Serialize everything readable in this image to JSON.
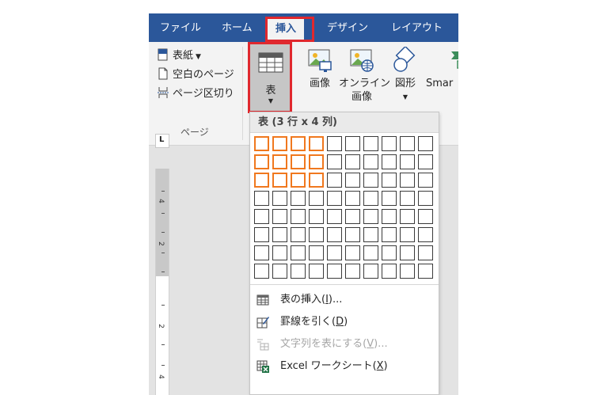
{
  "tabs": [
    {
      "label": "ファイル"
    },
    {
      "label": "ホーム"
    },
    {
      "label": "挿入"
    },
    {
      "label": "デザイン"
    },
    {
      "label": "レイアウト"
    }
  ],
  "active_tab": "挿入",
  "ribbon": {
    "pages_group": {
      "cover_page": "表紙",
      "blank_page": "空白のページ",
      "page_break": "ページ区切り",
      "label": "ページ"
    },
    "table_button": "表",
    "pictures_button": "画像",
    "online_pictures_line1": "オンライン",
    "online_pictures_line2": "画像",
    "shapes_button": "図形",
    "smartart_button": "Smar"
  },
  "colors": {
    "tab_bar": "#2b579a",
    "highlight": "#e0282e",
    "grid_selected": "#f0781e"
  },
  "ruler": {
    "corner_label": "L",
    "numbers": [
      "4",
      "2",
      "",
      "2",
      "4"
    ]
  },
  "dropdown": {
    "header": "表 (3 行 x 4 列)",
    "grid_rows": 8,
    "grid_cols": 10,
    "selected_rows": 3,
    "selected_cols": 4,
    "menu": {
      "insert_table": {
        "text": "表の挿入(",
        "key": "I",
        "tail": ")..."
      },
      "draw_table": {
        "text": "罫線を引く(",
        "key": "D",
        "tail": ")"
      },
      "text_to_table": {
        "text": "文字列を表にする(",
        "key": "V",
        "tail": ")..."
      },
      "excel_sheet": {
        "text": "Excel ワークシート(",
        "key": "X",
        "tail": ")"
      }
    }
  }
}
